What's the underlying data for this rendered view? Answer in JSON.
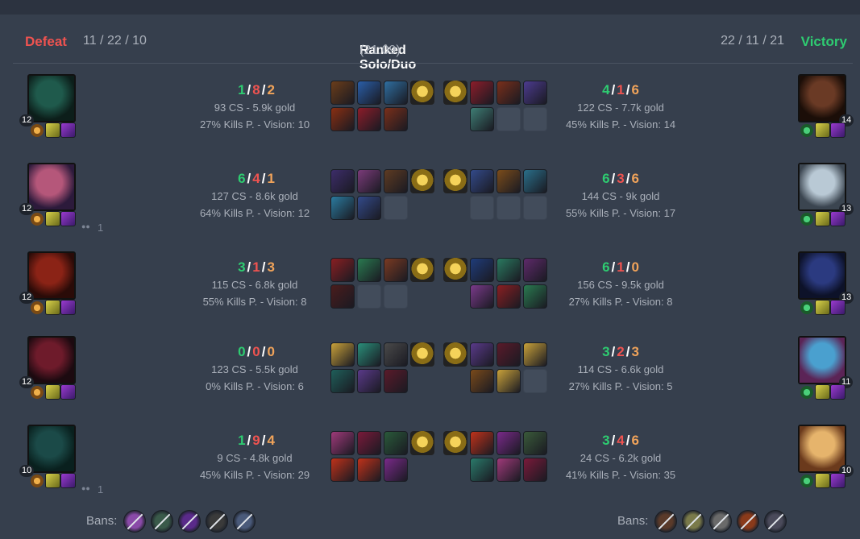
{
  "header": {
    "left_result": "Defeat",
    "left_kda": "11 / 22 / 10",
    "queue": "Ranked Solo/Duo",
    "duration": "(21:09)",
    "right_kda": "22 / 11 / 21",
    "right_result": "Victory"
  },
  "rows": [
    {
      "left": {
        "level": "12",
        "k": "1",
        "d": "8",
        "a": "2",
        "cs_gold": "93 CS - 5.9k gold",
        "kp_vision": "27% Kills P. - Vision: 10",
        "party": ""
      },
      "right": {
        "level": "14",
        "k": "4",
        "d": "1",
        "a": "6",
        "cs_gold": "122 CS - 7.7k gold",
        "kp_vision": "45% Kills P. - Vision: 14"
      }
    },
    {
      "left": {
        "level": "12",
        "k": "6",
        "d": "4",
        "a": "1",
        "cs_gold": "127 CS - 8.6k gold",
        "kp_vision": "64% Kills P. - Vision: 12",
        "party": "1"
      },
      "right": {
        "level": "13",
        "k": "6",
        "d": "3",
        "a": "6",
        "cs_gold": "144 CS - 9k gold",
        "kp_vision": "55% Kills P. - Vision: 17"
      }
    },
    {
      "left": {
        "level": "12",
        "k": "3",
        "d": "1",
        "a": "3",
        "cs_gold": "115 CS - 6.8k gold",
        "kp_vision": "55% Kills P. - Vision: 8",
        "party": ""
      },
      "right": {
        "level": "13",
        "k": "6",
        "d": "1",
        "a": "0",
        "cs_gold": "156 CS - 9.5k gold",
        "kp_vision": "27% Kills P. - Vision: 8"
      }
    },
    {
      "left": {
        "level": "12",
        "k": "0",
        "d": "0",
        "a": "0",
        "cs_gold": "123 CS - 5.5k gold",
        "kp_vision": "0% Kills P. - Vision: 6",
        "party": ""
      },
      "right": {
        "level": "11",
        "k": "3",
        "d": "2",
        "a": "3",
        "cs_gold": "114 CS - 6.6k gold",
        "kp_vision": "27% Kills P. - Vision: 5"
      }
    },
    {
      "left": {
        "level": "10",
        "k": "1",
        "d": "9",
        "a": "4",
        "cs_gold": "9 CS - 4.8k gold",
        "kp_vision": "45% Kills P. - Vision: 29",
        "party": "1"
      },
      "right": {
        "level": "10",
        "k": "3",
        "d": "4",
        "a": "6",
        "cs_gold": "24 CS - 6.2k gold",
        "kp_vision": "41% Kills P. - Vision: 35"
      }
    }
  ],
  "bans": {
    "left_label": "Bans:",
    "right_label": "Bans:",
    "left_icons": [
      "ban-icon",
      "ban-icon",
      "ban-icon",
      "ban-icon",
      "ban-icon"
    ],
    "right_icons": [
      "ban-icon",
      "ban-icon",
      "ban-icon",
      "ban-icon",
      "ban-icon"
    ]
  },
  "colors": {
    "defeat": "#ef5350",
    "victory": "#2ecc71",
    "kills": "#2ecc71",
    "deaths": "#ef5350",
    "assists": "#f0a35a",
    "background": "#363f4d"
  },
  "icons": {
    "party": "party-icon",
    "ward": "trinket-ward-icon",
    "item": "item-icon",
    "summoner_spell": "summoner-spell-icon",
    "rune": "keystone-rune-icon"
  }
}
